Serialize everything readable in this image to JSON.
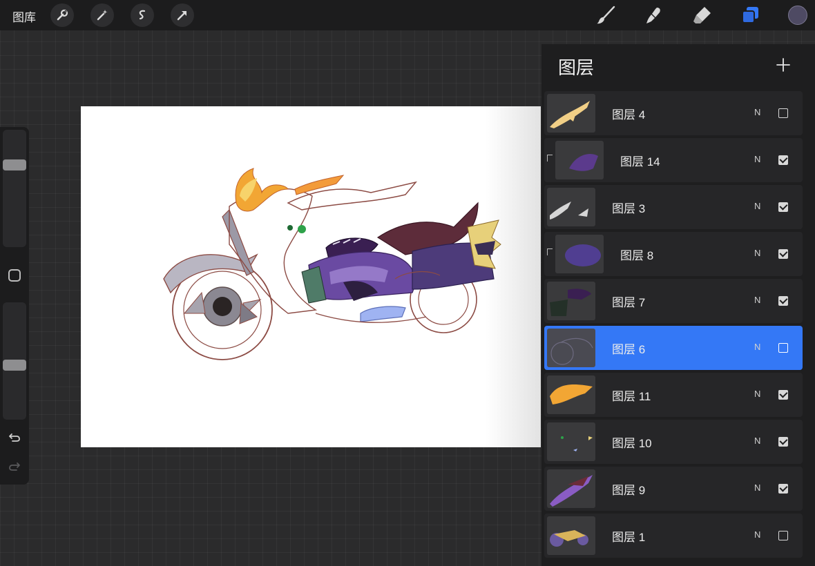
{
  "topbar": {
    "gallery_label": "图库",
    "left_tools": [
      {
        "name": "wrench-icon"
      },
      {
        "name": "magic-wand-icon"
      },
      {
        "name": "selection-icon"
      },
      {
        "name": "move-arrow-icon"
      }
    ],
    "right_tools": [
      {
        "name": "brush-icon"
      },
      {
        "name": "smudge-icon"
      },
      {
        "name": "eraser-icon"
      },
      {
        "name": "layers-icon",
        "active": true
      }
    ],
    "color_swatch": "#4e4a63",
    "accent": "#3478f6"
  },
  "sidebar": {
    "brush_size_level": 0.72,
    "opacity_level": 0.46,
    "icons": [
      "modify-square-icon",
      "undo-icon",
      "redo-icon"
    ]
  },
  "layers_panel": {
    "title": "图层",
    "add_icon": "plus-icon",
    "layers": [
      {
        "name": "图层 4",
        "blend": "N",
        "visible": false,
        "clipped": false,
        "selected": false
      },
      {
        "name": "图层 14",
        "blend": "N",
        "visible": true,
        "clipped": true,
        "selected": false
      },
      {
        "name": "图层 3",
        "blend": "N",
        "visible": true,
        "clipped": false,
        "selected": false
      },
      {
        "name": "图层 8",
        "blend": "N",
        "visible": true,
        "clipped": true,
        "selected": false
      },
      {
        "name": "图层 7",
        "blend": "N",
        "visible": true,
        "clipped": false,
        "selected": false
      },
      {
        "name": "图层 6",
        "blend": "N",
        "visible": false,
        "clipped": false,
        "selected": true
      },
      {
        "name": "图层 11",
        "blend": "N",
        "visible": true,
        "clipped": false,
        "selected": false
      },
      {
        "name": "图层 10",
        "blend": "N",
        "visible": true,
        "clipped": false,
        "selected": false
      },
      {
        "name": "图层 9",
        "blend": "N",
        "visible": true,
        "clipped": false,
        "selected": false
      },
      {
        "name": "图层 1",
        "blend": "N",
        "visible": false,
        "clipped": false,
        "selected": false
      }
    ]
  }
}
